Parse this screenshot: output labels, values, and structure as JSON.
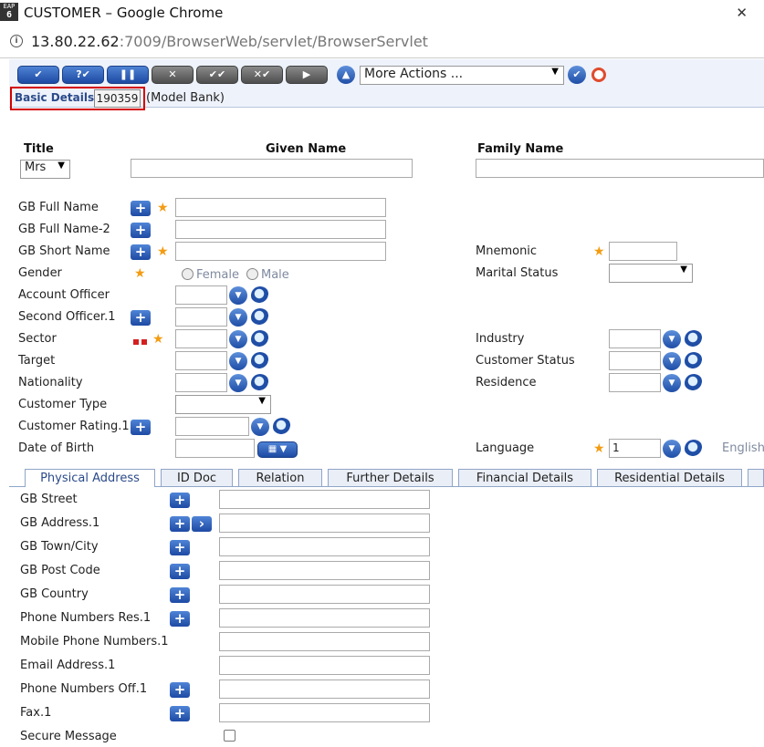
{
  "window": {
    "title": "CUSTOMER – Google Chrome",
    "icon_text_top": "EAP",
    "icon_text_bottom": "6"
  },
  "address": {
    "host": "13.80.22.62",
    "path": ":7009/BrowserWeb/servlet/BrowserServlet"
  },
  "toolbar": {
    "more_actions": "More Actions ...",
    "buttons": [
      "commit-icon",
      "validate-icon",
      "hold-icon",
      "delete-icon",
      "authorise-icon",
      "reverse-icon",
      "next-icon",
      "back-icon",
      "go-icon",
      "help-icon"
    ]
  },
  "record": {
    "tab_label": "Basic Details",
    "id": "190359",
    "company": "(Model Bank)"
  },
  "name_headers": {
    "title": "Title",
    "given": "Given Name",
    "family": "Family Name",
    "title_value": "Mrs"
  },
  "labels": {
    "gb_full_name": "GB Full Name",
    "gb_full_name_2": "GB Full Name-2",
    "gb_short_name": "GB Short Name",
    "gender": "Gender",
    "female": "Female",
    "male": "Male",
    "account_officer": "Account Officer",
    "second_officer": "Second Officer.1",
    "sector": "Sector",
    "target": "Target",
    "nationality": "Nationality",
    "customer_type": "Customer Type",
    "customer_rating": "Customer Rating.1",
    "date_of_birth": "Date of Birth",
    "mnemonic": "Mnemonic",
    "marital_status": "Marital Status",
    "industry": "Industry",
    "customer_status": "Customer Status",
    "residence": "Residence",
    "language": "Language",
    "language_value": "1",
    "language_name": "English"
  },
  "tabs": [
    "Physical Address",
    "ID Doc",
    "Relation",
    "Further Details",
    "Financial Details",
    "Residential Details"
  ],
  "address_fields": [
    "GB Street",
    "GB Address.1",
    "GB Town/City",
    "GB Post Code",
    "GB Country",
    "Phone Numbers Res.1",
    "Mobile Phone Numbers.1",
    "Email Address.1",
    "Phone Numbers Off.1",
    "Fax.1",
    "Secure Message"
  ],
  "colors": {
    "accent": "#1e4aa3",
    "required_star": "#f39c12",
    "highlight_box": "#d40000"
  }
}
